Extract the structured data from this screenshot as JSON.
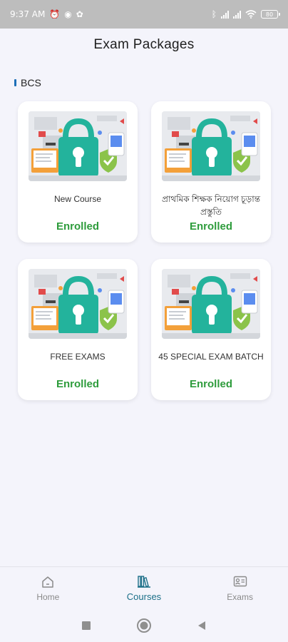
{
  "status_bar": {
    "time": "9:37 AM",
    "battery": "80"
  },
  "header": {
    "title": "Exam Packages"
  },
  "section": {
    "label": "BCS"
  },
  "cards": [
    {
      "title": "New Course",
      "status": "Enrolled"
    },
    {
      "title": "প্রাথমিক শিক্ষক নিয়োগ চূড়ান্ত প্রস্তুতি",
      "status": "Enrolled"
    },
    {
      "title": "FREE EXAMS",
      "status": "Enrolled"
    },
    {
      "title": "45 SPECIAL EXAM BATCH",
      "status": "Enrolled"
    }
  ],
  "bottom_nav": {
    "items": [
      {
        "label": "Home",
        "icon": "home-icon",
        "active": false
      },
      {
        "label": "Courses",
        "icon": "courses-icon",
        "active": true
      },
      {
        "label": "Exams",
        "icon": "exams-icon",
        "active": false
      }
    ]
  },
  "colors": {
    "enrolled": "#2e9c3c",
    "active_nav": "#1b6f88",
    "lock_teal": "#23b39c",
    "background": "#f4f4fb"
  }
}
